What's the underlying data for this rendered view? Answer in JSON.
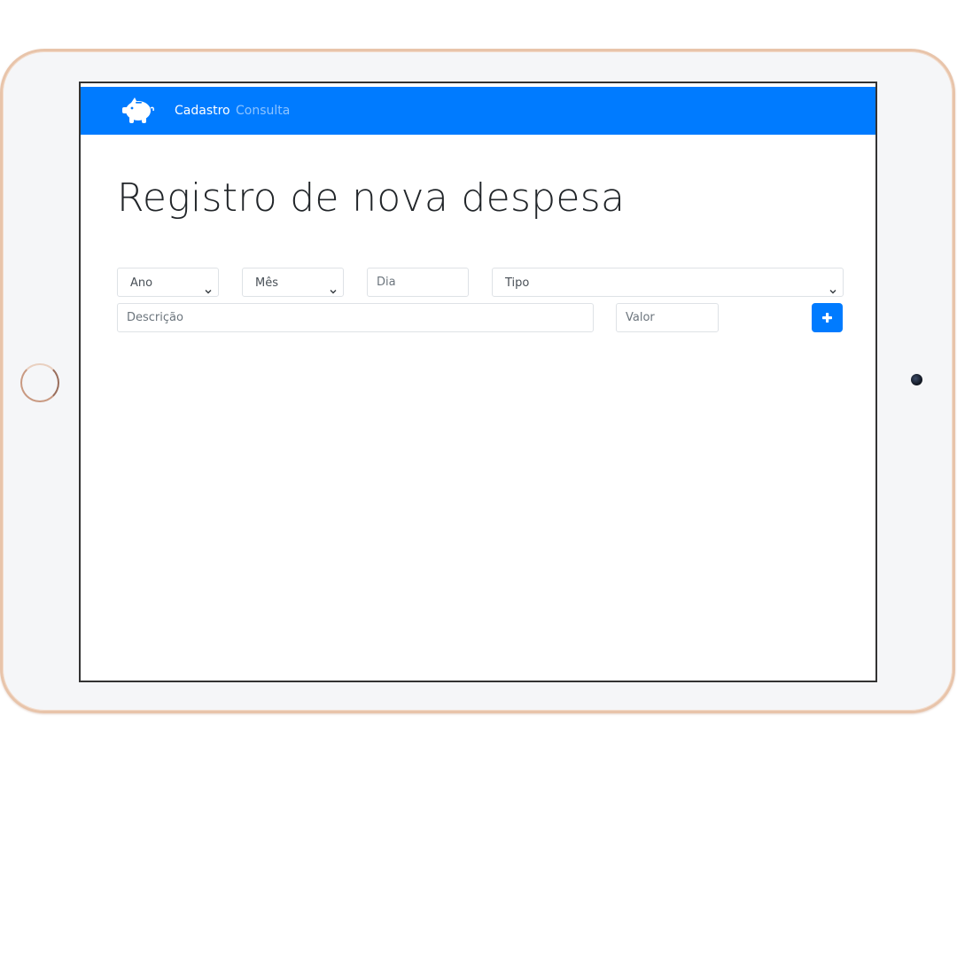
{
  "nav": {
    "logo_icon": "piggy-bank-icon",
    "links": [
      {
        "label": "Cadastro",
        "active": true
      },
      {
        "label": "Consulta",
        "active": false
      }
    ]
  },
  "page": {
    "title": "Registro de nova despesa"
  },
  "form": {
    "ano": {
      "selected": "Ano",
      "icon": "chevron-down-icon"
    },
    "mes": {
      "selected": "Mês",
      "icon": "chevron-down-icon"
    },
    "dia": {
      "placeholder": "Dia",
      "value": ""
    },
    "tipo": {
      "selected": "Tipo",
      "icon": "chevron-down-icon"
    },
    "descricao": {
      "placeholder": "Descrição",
      "value": ""
    },
    "valor": {
      "placeholder": "Valor",
      "value": ""
    },
    "add_button": {
      "icon": "plus-icon"
    }
  },
  "colors": {
    "primary": "#007bff",
    "bezel": "#f5f6f8",
    "frame": "#e8c4aa"
  }
}
